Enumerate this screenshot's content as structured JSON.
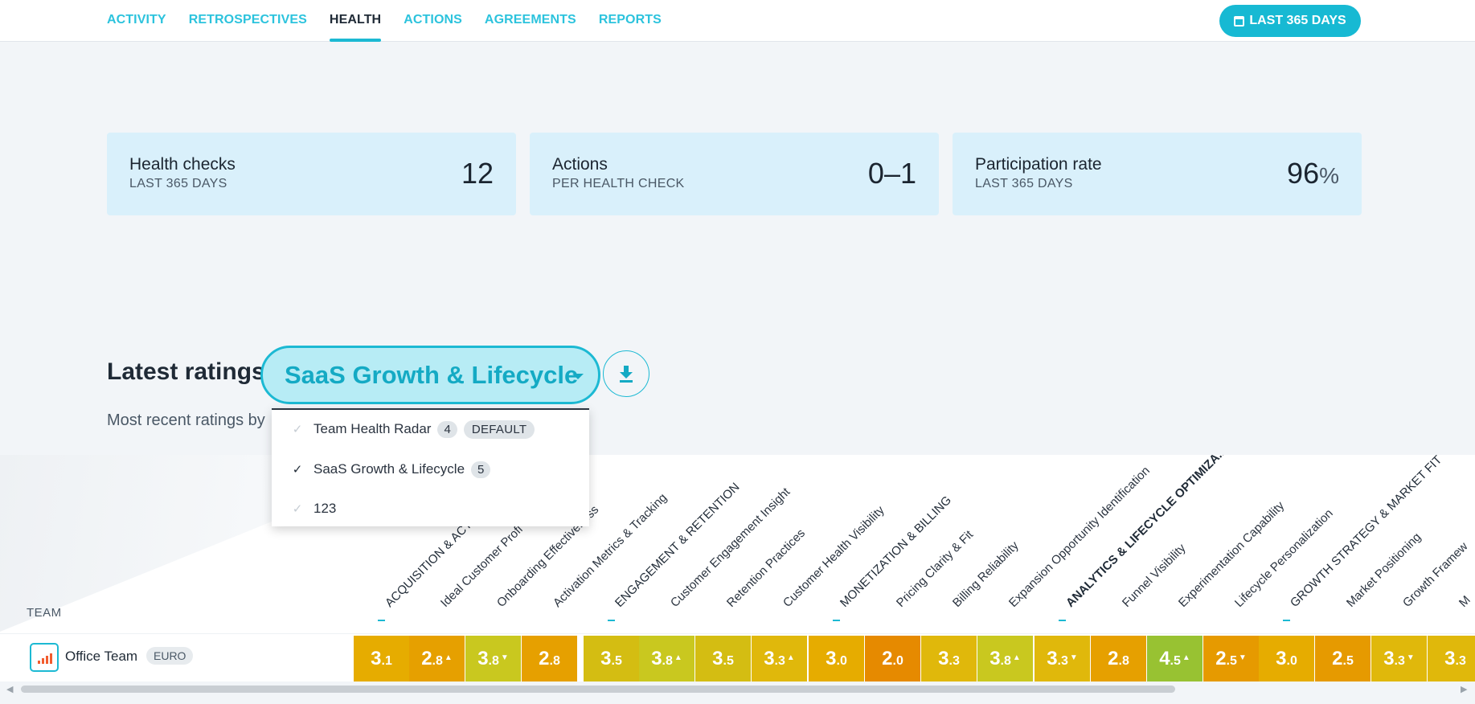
{
  "nav": {
    "tabs": [
      {
        "label": "ACTIVITY",
        "active": false
      },
      {
        "label": "RETROSPECTIVES",
        "active": false
      },
      {
        "label": "HEALTH",
        "active": true
      },
      {
        "label": "ACTIONS",
        "active": false
      },
      {
        "label": "AGREEMENTS",
        "active": false
      },
      {
        "label": "REPORTS",
        "active": false
      }
    ],
    "date_range": "LAST 365 DAYS"
  },
  "stats": [
    {
      "title": "Health checks",
      "subtitle": "LAST 365 DAYS",
      "value": "12",
      "unit": ""
    },
    {
      "title": "Actions",
      "subtitle": "PER HEALTH CHECK",
      "value": "0–1",
      "unit": ""
    },
    {
      "title": "Participation rate",
      "subtitle": "LAST 365 DAYS",
      "value": "96",
      "unit": "%"
    }
  ],
  "latest": {
    "title": "Latest ratings",
    "selected_template": "SaaS Growth & Lifecycle",
    "subtitle": "Most recent ratings by",
    "download_icon": "download-icon"
  },
  "dropdown": {
    "items": [
      {
        "label": "Team Health Radar",
        "count": "4",
        "badge": "DEFAULT",
        "checked": false
      },
      {
        "label": "SaaS Growth & Lifecycle",
        "count": "5",
        "badge": "",
        "checked": true
      },
      {
        "label": "123",
        "count": "",
        "badge": "",
        "checked": false
      }
    ]
  },
  "matrix": {
    "team_header": "TEAM",
    "columns": [
      {
        "label": "ACQUISITION & ACTI",
        "category": true
      },
      {
        "label": "Ideal Customer Profi",
        "category": false
      },
      {
        "label": "Onboarding Effectiveness",
        "category": false
      },
      {
        "label": "Activation Metrics & Tracking",
        "category": false
      },
      {
        "label": "ENGAGEMENT & RETENTION",
        "category": true
      },
      {
        "label": "Customer Engagement Insight",
        "category": false
      },
      {
        "label": "Retention Practices",
        "category": false
      },
      {
        "label": "Customer Health Visibility",
        "category": false
      },
      {
        "label": "MONETIZATION & BILLING",
        "category": true
      },
      {
        "label": "Pricing Clarity & Fit",
        "category": false
      },
      {
        "label": "Billing Reliability",
        "category": false
      },
      {
        "label": "Expansion Opportunity Identification",
        "category": false
      },
      {
        "label": "ANALYTICS & LIFECYCLE OPTIMIZA...",
        "category": true,
        "bold": true
      },
      {
        "label": "Funnel Visibility",
        "category": false
      },
      {
        "label": "Experimentation Capability",
        "category": false
      },
      {
        "label": "Lifecycle Personalization",
        "category": false
      },
      {
        "label": "GROWTH STRATEGY & MARKET FIT",
        "category": true
      },
      {
        "label": "Market Positioning",
        "category": false
      },
      {
        "label": "Growth Framew",
        "category": false
      },
      {
        "label": "M",
        "category": false
      }
    ],
    "team": {
      "name": "Office Team",
      "tag": "EURO",
      "icon": "bar-chart-icon"
    },
    "ratings": [
      {
        "int": "3",
        "dec": ".1",
        "trend": "",
        "color": "#e6ac00"
      },
      {
        "int": "2",
        "dec": ".8",
        "trend": "▲",
        "color": "#e6a000"
      },
      {
        "int": "3",
        "dec": ".8",
        "trend": "▼",
        "color": "#c9c81f"
      },
      {
        "int": "2",
        "dec": ".8",
        "trend": "",
        "color": "#e6a000"
      },
      {
        "int": "3",
        "dec": ".5",
        "trend": "",
        "color": "#d4bd12"
      },
      {
        "int": "3",
        "dec": ".8",
        "trend": "▲",
        "color": "#c9c81f"
      },
      {
        "int": "3",
        "dec": ".5",
        "trend": "",
        "color": "#d4bd12"
      },
      {
        "int": "3",
        "dec": ".3",
        "trend": "▲",
        "color": "#e0b80b"
      },
      {
        "int": "3",
        "dec": ".0",
        "trend": "",
        "color": "#e6ac00"
      },
      {
        "int": "2",
        "dec": ".0",
        "trend": "",
        "color": "#e68a00"
      },
      {
        "int": "3",
        "dec": ".3",
        "trend": "",
        "color": "#e0b80b"
      },
      {
        "int": "3",
        "dec": ".8",
        "trend": "▲",
        "color": "#c9c81f"
      },
      {
        "int": "3",
        "dec": ".3",
        "trend": "▼",
        "color": "#e0b80b"
      },
      {
        "int": "2",
        "dec": ".8",
        "trend": "",
        "color": "#e6a000"
      },
      {
        "int": "4",
        "dec": ".5",
        "trend": "▲",
        "color": "#98c232"
      },
      {
        "int": "2",
        "dec": ".5",
        "trend": "▼",
        "color": "#e69a00"
      },
      {
        "int": "3",
        "dec": ".0",
        "trend": "",
        "color": "#e6ac00"
      },
      {
        "int": "2",
        "dec": ".5",
        "trend": "",
        "color": "#e69a00"
      },
      {
        "int": "3",
        "dec": ".3",
        "trend": "▼",
        "color": "#e0b80b"
      },
      {
        "int": "3",
        "dec": ".3",
        "trend": "",
        "color": "#e0b80b"
      }
    ]
  }
}
